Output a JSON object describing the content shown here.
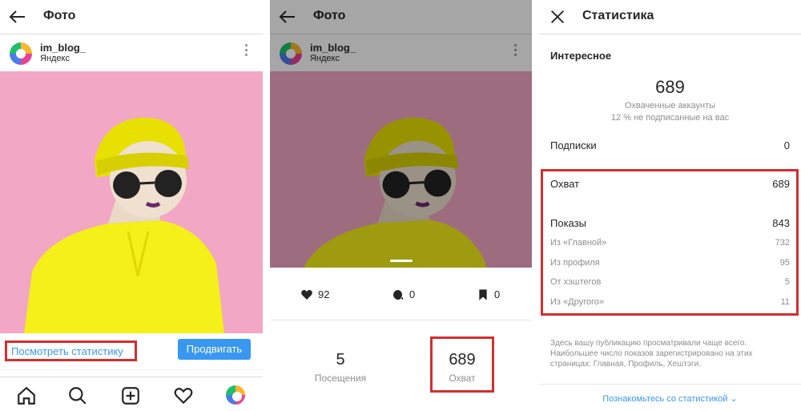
{
  "panel1": {
    "title": "Фото",
    "user": {
      "name": "im_blog_",
      "location": "Яндекс"
    },
    "view_stats": "Посмотреть статистику",
    "promote": "Продвигать"
  },
  "panel2": {
    "title": "Фото",
    "user": {
      "name": "im_blog_",
      "location": "Яндекс"
    },
    "likes": "92",
    "comments": "0",
    "saves": "0",
    "visits": {
      "value": "5",
      "label": "Посещения"
    },
    "reach": {
      "value": "689",
      "label": "Охват"
    }
  },
  "panel3": {
    "title": "Статистика",
    "section": "Интересное",
    "accounts_value": "689",
    "accounts_label": "Охваченные аккаунты",
    "not_following": "12 % не подписанные на вас",
    "follows": {
      "label": "Подписки",
      "value": "0"
    },
    "reach": {
      "label": "Охват",
      "value": "689"
    },
    "impressions": {
      "label": "Показы",
      "value": "843"
    },
    "sources": [
      {
        "label": "Из «Главной»",
        "value": "732"
      },
      {
        "label": "Из профиля",
        "value": "95"
      },
      {
        "label": "От хэштегов",
        "value": "5"
      },
      {
        "label": "Из «Другого»",
        "value": "11"
      }
    ],
    "note": "Здесь вашу публикацию просматривали чаще всего. Наибольшее число показов зарегистрировано на этих страницах: Главная, Профиль, Хештэги.",
    "footer_link": "Познакомьтесь со статистикой"
  },
  "colors": {
    "accent_blue": "#3897f0",
    "highlight_red": "#d32f2f",
    "photo_bg": "#f2a7c4",
    "outfit_yellow": "#f5ef1a"
  }
}
